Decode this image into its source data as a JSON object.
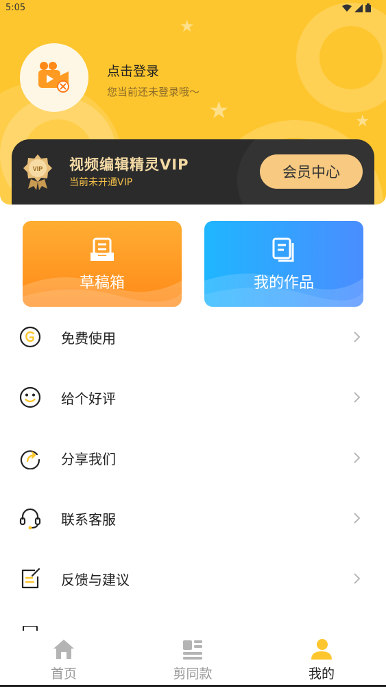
{
  "status_bar": {
    "time": "5:05",
    "icons": [
      "wifi-icon",
      "signal-icon",
      "battery-icon"
    ]
  },
  "profile": {
    "login_title": "点击登录",
    "login_subtitle": "您当前还未登录哦～"
  },
  "vip": {
    "badge_text": "VIP",
    "title": "视频编辑精灵VIP",
    "subtitle": "当前未开通VIP",
    "button_label": "会员中心"
  },
  "tiles": [
    {
      "label": "草稿箱",
      "icon": "drafts-icon"
    },
    {
      "label": "我的作品",
      "icon": "my-works-icon"
    }
  ],
  "menu": [
    {
      "label": "免费使用",
      "icon": "free-use-icon"
    },
    {
      "label": "给个好评",
      "icon": "smile-icon"
    },
    {
      "label": "分享我们",
      "icon": "share-icon"
    },
    {
      "label": "联系客服",
      "icon": "headset-icon"
    },
    {
      "label": "反馈与建议",
      "icon": "feedback-icon"
    }
  ],
  "tabbar": [
    {
      "label": "首页",
      "icon": "home-icon",
      "active": false
    },
    {
      "label": "剪同款",
      "icon": "template-icon",
      "active": false
    },
    {
      "label": "我的",
      "icon": "user-icon",
      "active": true
    }
  ],
  "colors": {
    "header_yellow": "#fec62e",
    "vip_card_dark": "#2b2b2b",
    "vip_gold_text": "#f3d9a4",
    "vip_button": "#f7c77c",
    "tile_orange": "#ff8a18",
    "tile_blue": "#4a8dff",
    "tab_active_yellow": "#fec62e",
    "tab_inactive_gray": "#999999"
  }
}
